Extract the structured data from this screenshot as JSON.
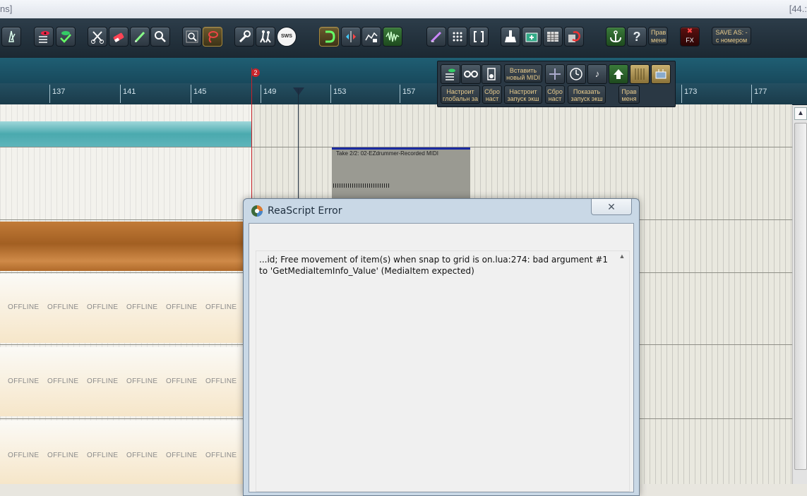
{
  "window": {
    "title_left": "ns]",
    "title_right": "[44.:"
  },
  "ruler": {
    "bars": [
      "137",
      "141",
      "145",
      "149",
      "153",
      "157",
      "173",
      "177"
    ],
    "marker_number": "2"
  },
  "toolbar": {
    "buttons": [
      {
        "icon": "metronome-icon"
      },
      {
        "icon": "mixer-eye-icon"
      },
      {
        "icon": "checkmark-eye-icon"
      },
      {
        "icon": "scissors-icon"
      },
      {
        "icon": "eraser-icon"
      },
      {
        "icon": "pencil-icon"
      },
      {
        "icon": "zoom-icon"
      },
      {
        "icon": "search-icon"
      },
      {
        "icon": "lasso-icon"
      },
      {
        "icon": "wrench-icon"
      },
      {
        "icon": "walkers-icon"
      },
      {
        "icon": "sws-icon"
      },
      {
        "icon": "snap-icon"
      },
      {
        "icon": "ripple-icon"
      },
      {
        "icon": "envelope-lock-icon"
      },
      {
        "icon": "waveform-icon"
      },
      {
        "icon": "edit-pen-icon"
      },
      {
        "icon": "grid-icon"
      },
      {
        "icon": "bracket-icon"
      },
      {
        "icon": "broom-icon"
      },
      {
        "icon": "folder-plus-icon"
      },
      {
        "icon": "table-icon"
      },
      {
        "icon": "render-icon"
      },
      {
        "icon": "anchor-icon"
      },
      {
        "icon": "help-icon"
      }
    ],
    "sws_label": "SWS",
    "help_label": "?",
    "pravmenya_label": "Прав меня",
    "fx_label": "FX",
    "save_as_label": "SAVE AS: - с номером"
  },
  "float_toolbar": {
    "insert_midi": "Вставить новый MIDI",
    "global_settings": "Настроит глобальн за",
    "reset1": "Сбро наст",
    "launch_settings": "Настроит запуск экш",
    "reset2": "Сбро наст",
    "show_launch": "Показать запуск экш",
    "pravmenya": "Прав меня"
  },
  "arrange": {
    "midi_item_label": "Take 2/2: 02-EZdrummer-Recorded MIDI",
    "offline_label": "OFFLINE"
  },
  "dialog": {
    "title": "ReaScript Error",
    "close_glyph": "✕",
    "message": "...id; Free movement of item(s) when snap to grid is on.lua:274: bad argument #1 to 'GetMediaItemInfo_Value' (MediaItem expected)"
  },
  "colors": {
    "toolbar_bg": "#22303b",
    "ruler_bg": "#1f5e73",
    "teal_item": "#5fb5bb",
    "orange_item": "#b06a2a",
    "dialog_frame": "#c9d8e6",
    "text_gold": "#e6c98a"
  }
}
